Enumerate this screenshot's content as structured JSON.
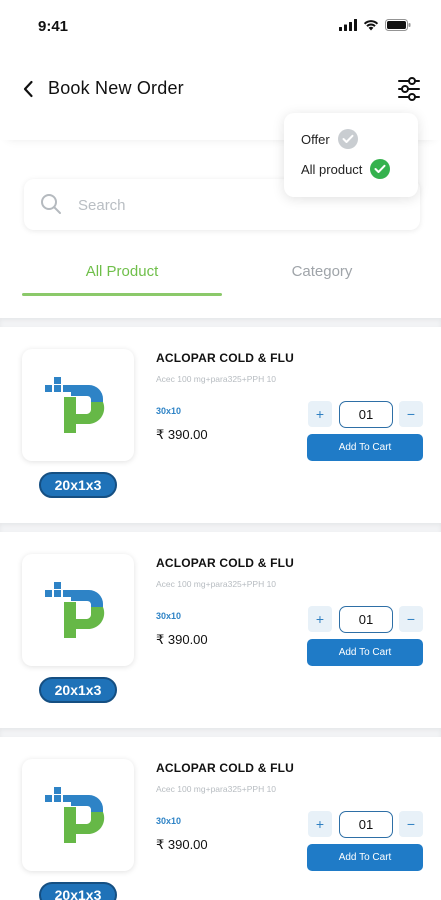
{
  "status_bar": {
    "time": "9:41"
  },
  "header": {
    "title": "Book New Order"
  },
  "filter_menu": {
    "items": [
      {
        "label": "Offer",
        "checked": false
      },
      {
        "label": "All product",
        "checked": true
      }
    ]
  },
  "search": {
    "placeholder": "Search",
    "value": ""
  },
  "tabs": [
    {
      "label": "All Product",
      "active": true
    },
    {
      "label": "Category",
      "active": false
    }
  ],
  "colors": {
    "accent_green": "#6fbf4a",
    "primary_blue": "#1f7bc7",
    "check_green": "#35b24e"
  },
  "products": [
    {
      "name": "ACLOPAR COLD & FLU",
      "composition": "Acec 100 mg+para325+PPH 10",
      "pack": "30x10",
      "price": "₹ 390.00",
      "quantity": "01",
      "add_label": "Add To Cart",
      "badge": "20x1x3",
      "plus": "+",
      "minus": "−"
    },
    {
      "name": "ACLOPAR COLD & FLU",
      "composition": "Acec 100 mg+para325+PPH 10",
      "pack": "30x10",
      "price": "₹ 390.00",
      "quantity": "01",
      "add_label": "Add To Cart",
      "badge": "20x1x3",
      "plus": "+",
      "minus": "−"
    },
    {
      "name": "ACLOPAR COLD & FLU",
      "composition": "Acec 100 mg+para325+PPH 10",
      "pack": "30x10",
      "price": "₹ 390.00",
      "quantity": "01",
      "add_label": "Add To Cart",
      "badge": "20x1x3",
      "plus": "+",
      "minus": "−"
    }
  ]
}
